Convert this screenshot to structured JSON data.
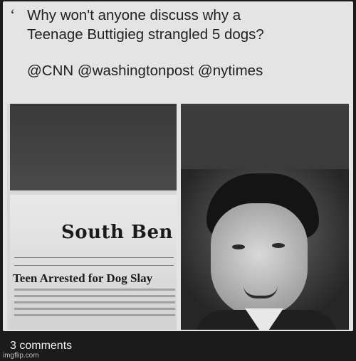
{
  "post": {
    "line1": "Why won't anyone discuss why a",
    "line2": "Teenage Buttigieg strangled 5 dogs?",
    "mentions": "@CNN @washingtonpost @nytimes"
  },
  "newspaper": {
    "masthead": "South Ben",
    "headline": "Teen Arrested for Dog Slay"
  },
  "footer": {
    "comments": "3 comments",
    "watermark": "imgflip.com"
  },
  "colors": {
    "background": "#1c1c1c",
    "card": "#e4e4e4",
    "text": "#222222",
    "footer_text": "#f2f2f2"
  }
}
